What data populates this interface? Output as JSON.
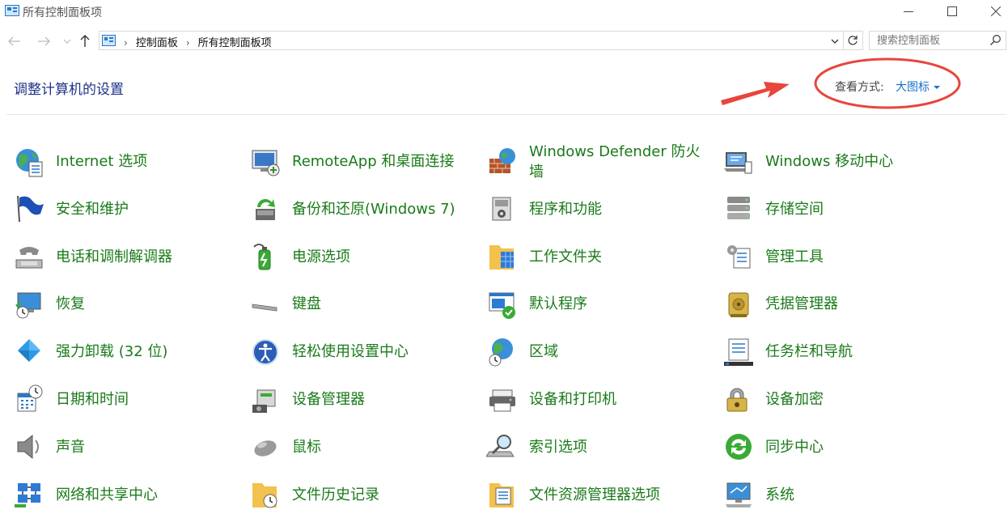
{
  "window": {
    "title": "所有控制面板项"
  },
  "address": {
    "crumbs": [
      "控制面板",
      "所有控制面板项"
    ],
    "search_placeholder": "搜索控制面板"
  },
  "header": {
    "title": "调整计算机的设置",
    "view_label": "查看方式:",
    "view_value": "大图标"
  },
  "colors": {
    "link_green": "#1a7a1a",
    "title_blue": "#1e3287",
    "annotation_red": "#e8453c"
  },
  "items": [
    [
      "Internet 选项",
      "RemoteApp 和桌面连接",
      "Windows Defender 防火\n墙",
      "Windows 移动中心"
    ],
    [
      "安全和维护",
      "备份和还原(Windows 7)",
      "程序和功能",
      "存储空间"
    ],
    [
      "电话和调制解调器",
      "电源选项",
      "工作文件夹",
      "管理工具"
    ],
    [
      "恢复",
      "键盘",
      "默认程序",
      "凭据管理器"
    ],
    [
      "强力卸载 (32 位)",
      "轻松使用设置中心",
      "区域",
      "任务栏和导航"
    ],
    [
      "日期和时间",
      "设备管理器",
      "设备和打印机",
      "设备加密"
    ],
    [
      "声音",
      "鼠标",
      "索引选项",
      "同步中心"
    ],
    [
      "网络和共享中心",
      "文件历史记录",
      "文件资源管理器选项",
      "系统"
    ]
  ]
}
